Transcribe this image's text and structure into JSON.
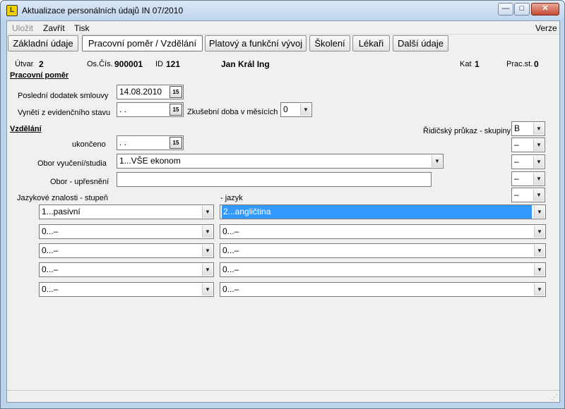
{
  "window": {
    "title": "Aktualizace personálních údajů     IN  07/2010",
    "app_icon": "app-logo-icon"
  },
  "titlebar_buttons": {
    "minimize": "—",
    "maximize": "□",
    "close": "✕"
  },
  "menu": {
    "ulozit": "Uložit",
    "zavrit": "Zavřít",
    "tisk": "Tisk",
    "verze": "Verze"
  },
  "tabs": [
    {
      "label": "Základní údaje"
    },
    {
      "label": "Pracovní poměr / Vzdělání"
    },
    {
      "label": "Platový a funkční vývoj"
    },
    {
      "label": "Školení"
    },
    {
      "label": "Lékaři"
    },
    {
      "label": "Další údaje"
    }
  ],
  "header": {
    "utvar_label": "Útvar",
    "utvar_value": "2",
    "oscis_label": "Os.Čís.",
    "oscis_value": "900001",
    "id_label": "ID",
    "id_value": "121",
    "name": "Jan Král Ing",
    "kat_label": "Kat",
    "kat_value": "1",
    "pracst_label": "Prac.st.",
    "pracst_value": "0"
  },
  "pracovni_pomer": {
    "section_title": "Pracovní poměr",
    "posledni_dodatek_label": "Poslední dodatek smlouvy",
    "posledni_dodatek_value": "14.08.2010",
    "vynet_label": "Vynětí z evidenčního stavu",
    "vynet_value": " .  .",
    "zkusebni_label": "Zkušební doba v měsících",
    "zkusebni_value": "0"
  },
  "vzdelani": {
    "section_title": "Vzdělání",
    "ukonceno_label": "ukončeno",
    "ukonceno_value": " .  .",
    "obor_label": "Obor vyučení/studia",
    "obor_value": "1...VŠE ekonom",
    "obor_upresneni_label": "Obor - upřesnění",
    "obor_upresneni_value": ""
  },
  "ridicsky": {
    "label": "Řidičský průkaz - skupiny",
    "groups": [
      "B",
      "–",
      "–",
      "–",
      "–"
    ]
  },
  "jazyky": {
    "stupen_label": "Jazykové znalosti - stupeň",
    "jazyk_label": "- jazyk",
    "rows": [
      {
        "stupen": "1...pasivní",
        "jazyk": "2...angličtina"
      },
      {
        "stupen": "0...–",
        "jazyk": "0...–"
      },
      {
        "stupen": "0...–",
        "jazyk": "0...–"
      },
      {
        "stupen": "0...–",
        "jazyk": "0...–"
      },
      {
        "stupen": "0...–",
        "jazyk": "0...–"
      }
    ]
  },
  "icons": {
    "calendar": "15",
    "dropdown": "▼",
    "grip": "⋰"
  }
}
